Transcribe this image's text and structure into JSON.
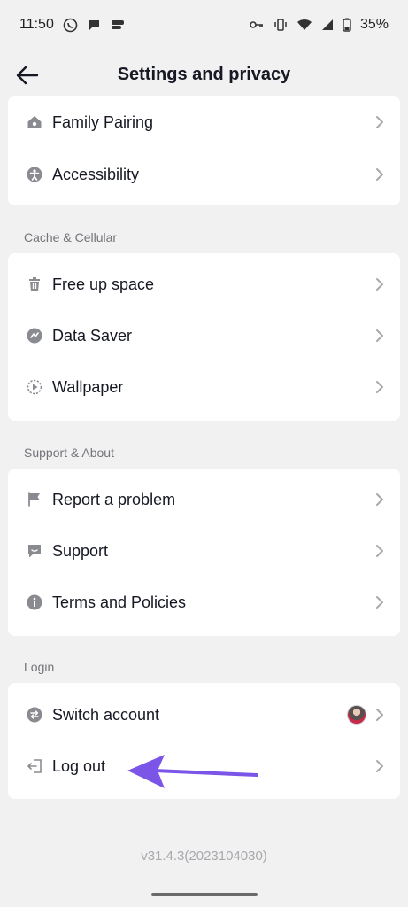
{
  "status_bar": {
    "time": "11:50",
    "battery": "35%"
  },
  "header": {
    "title": "Settings and privacy"
  },
  "top_group": {
    "items": [
      {
        "label": "Family Pairing",
        "icon": "home-icon"
      },
      {
        "label": "Accessibility",
        "icon": "accessibility-icon"
      }
    ]
  },
  "cache_section": {
    "title": "Cache & Cellular",
    "items": [
      {
        "label": "Free up space",
        "icon": "trash-icon"
      },
      {
        "label": "Data Saver",
        "icon": "data-saver-icon"
      },
      {
        "label": "Wallpaper",
        "icon": "wallpaper-icon"
      }
    ]
  },
  "support_section": {
    "title": "Support & About",
    "items": [
      {
        "label": "Report a problem",
        "icon": "flag-icon"
      },
      {
        "label": "Support",
        "icon": "chat-icon"
      },
      {
        "label": "Terms and Policies",
        "icon": "info-icon"
      }
    ]
  },
  "login_section": {
    "title": "Login",
    "items": [
      {
        "label": "Switch account",
        "icon": "switch-icon"
      },
      {
        "label": "Log out",
        "icon": "logout-icon"
      }
    ]
  },
  "version": "v31.4.3(2023104030)",
  "colors": {
    "background": "#f1f1f2",
    "card": "#ffffff",
    "icon": "#8a8b91",
    "arrow": "#7b54e8"
  }
}
